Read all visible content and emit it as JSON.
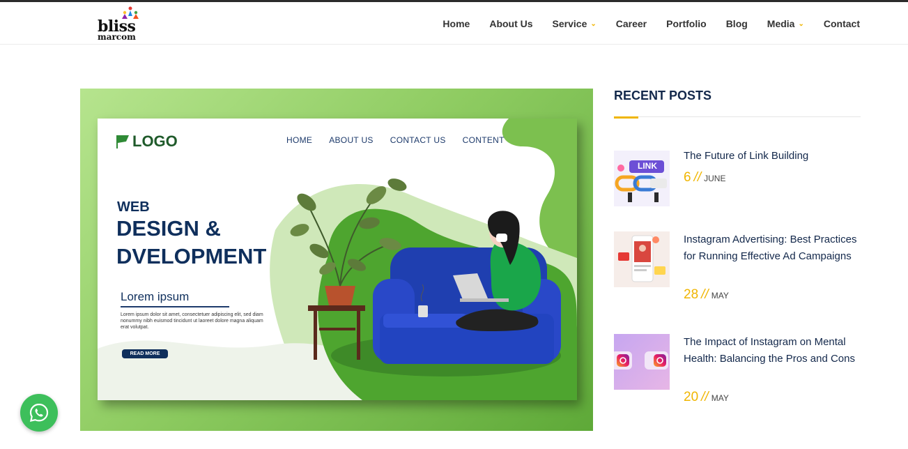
{
  "header": {
    "logo": {
      "line1": "bliss",
      "line2": "marcom"
    },
    "nav": [
      {
        "label": "Home",
        "has_dropdown": false
      },
      {
        "label": "About Us",
        "has_dropdown": false
      },
      {
        "label": "Service",
        "has_dropdown": true
      },
      {
        "label": "Career",
        "has_dropdown": false
      },
      {
        "label": "Portfolio",
        "has_dropdown": false
      },
      {
        "label": "Blog",
        "has_dropdown": false
      },
      {
        "label": "Media",
        "has_dropdown": true
      },
      {
        "label": "Contact",
        "has_dropdown": false
      }
    ]
  },
  "hero": {
    "logo_text": "LOGO",
    "nav": [
      "HOME",
      "ABOUT US",
      "CONTACT  US",
      "CONTENT"
    ],
    "heading_small": "WEB",
    "heading_large": "DESIGN & DVELOPMENT",
    "subheading": "Lorem ipsum",
    "body": "Lorem ipsum dolor sit amet, consectetuer adipiscing elit, sed diam nonummy nibh euismod tincidunt ut laoreet dolore magna aliquam erat volutpat.",
    "button": "READ MORE"
  },
  "sidebar": {
    "title": "RECENT POSTS",
    "posts": [
      {
        "title": "The Future of Link Building",
        "day": "6",
        "sep": "//",
        "month": "JUNE",
        "thumb_text": "LINK"
      },
      {
        "title": "Instagram Advertising: Best Practices for Running Effective Ad Campaigns",
        "day": "28",
        "sep": "//",
        "month": "MAY"
      },
      {
        "title": "The Impact of Instagram on Mental Health: Balancing the Pros and Cons",
        "day": "20",
        "sep": "//",
        "month": "MAY"
      }
    ]
  },
  "colors": {
    "accent": "#f0b500",
    "navy": "#13284b",
    "green": "#8fcc62",
    "whatsapp": "#3dbf5b"
  },
  "icons": {
    "whatsapp": "whatsapp-icon",
    "dropdown": "chevron-down-icon"
  }
}
